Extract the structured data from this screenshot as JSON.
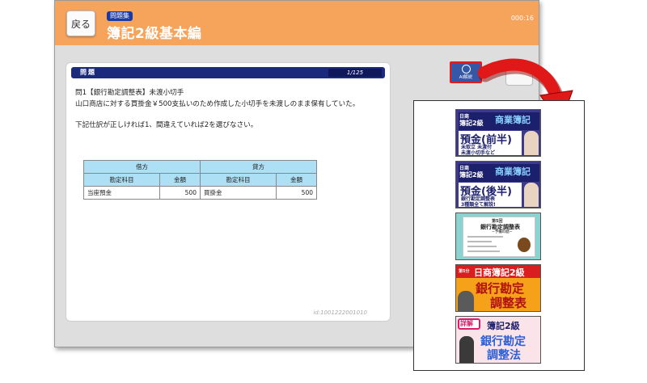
{
  "app": {
    "back_label": "戻る",
    "badge": "問題集",
    "title": "簿記2級基本編",
    "timer": "000:16"
  },
  "question": {
    "section_title": "問題",
    "counter": "1/125",
    "line1": "問1【銀行勘定調整表】未渡小切手",
    "line2": "山口商店に対する買掛金￥500支払いのため作成した小切手を未渡しのまま保有していた。",
    "instruction": "下記仕訳が正しければ1、間違えていれば2を選びなさい。",
    "table": {
      "debit_header": "借方",
      "credit_header": "貸方",
      "col_account": "勘定科目",
      "col_amount": "金額",
      "debit_account": "当座預金",
      "debit_amount": "500",
      "credit_account": "買掛金",
      "credit_amount": "500"
    },
    "id": "id:1001222001010"
  },
  "ai_button": {
    "label": "AI解説",
    "icon": "magnifier-icon"
  },
  "colors": {
    "header": "#f6a35c",
    "bar": "#1c2a7c",
    "accent_red": "#e21b1b"
  },
  "videos": [
    {
      "tag": "日商",
      "l1": "簿記2級",
      "l2": "商業簿記",
      "big": "預金(前半)",
      "sub1": "未取立 未渡付",
      "sub2": "未渡小切手など"
    },
    {
      "tag": "日商",
      "l1": "簿記2級",
      "l2": "商業簿記",
      "big": "預金(後半)",
      "sub1": "銀行勘定調整表",
      "sub2": "3種類全て解説!"
    },
    {
      "l1": "第5回",
      "l2": "銀行勘定調整表",
      "sub1": "~予備の話~"
    },
    {
      "tag": "第5分",
      "l1": "日商簿記2級",
      "big": "銀行勘定",
      "big2": "調整表"
    },
    {
      "tag": "詳解",
      "l1": "簿記2級",
      "big": "銀行勘定",
      "big2": "調整法"
    }
  ]
}
